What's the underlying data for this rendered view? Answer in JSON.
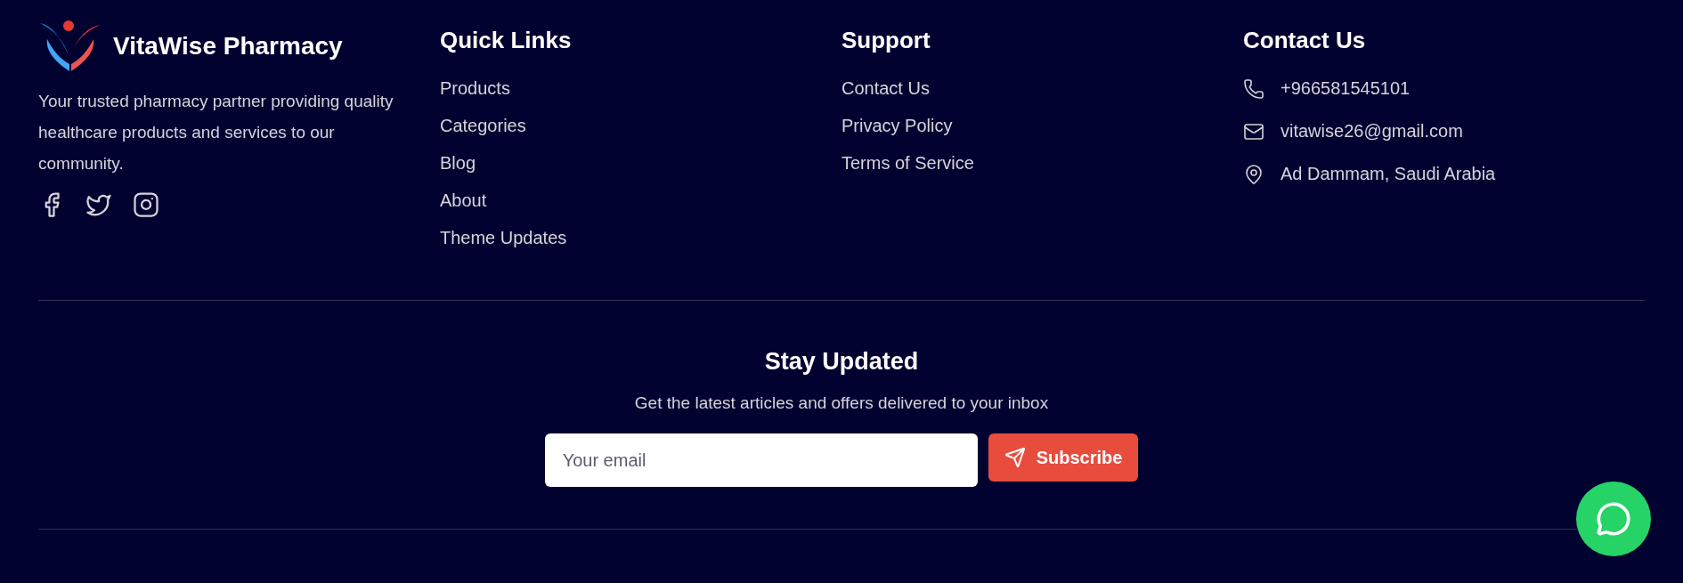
{
  "brand": {
    "name": "VitaWise Pharmacy",
    "description": "Your trusted pharmacy partner providing quality healthcare products and services to our community.",
    "social": [
      {
        "kind": "facebook"
      },
      {
        "kind": "twitter"
      },
      {
        "kind": "instagram"
      }
    ]
  },
  "quick_links": {
    "title": "Quick Links",
    "items": [
      "Products",
      "Categories",
      "Blog",
      "About",
      "Theme Updates"
    ]
  },
  "support": {
    "title": "Support",
    "items": [
      "Contact Us",
      "Privacy Policy",
      "Terms of Service"
    ]
  },
  "contact": {
    "title": "Contact Us",
    "items": [
      {
        "kind": "phone",
        "text": "+966581545101"
      },
      {
        "kind": "email",
        "text": "vitawise26@gmail.com"
      },
      {
        "kind": "location",
        "text": "Ad Dammam, Saudi Arabia"
      }
    ]
  },
  "newsletter": {
    "title": "Stay Updated",
    "subtitle": "Get the latest articles and offers delivered to your inbox",
    "placeholder": "Your email",
    "button": "Subscribe"
  }
}
